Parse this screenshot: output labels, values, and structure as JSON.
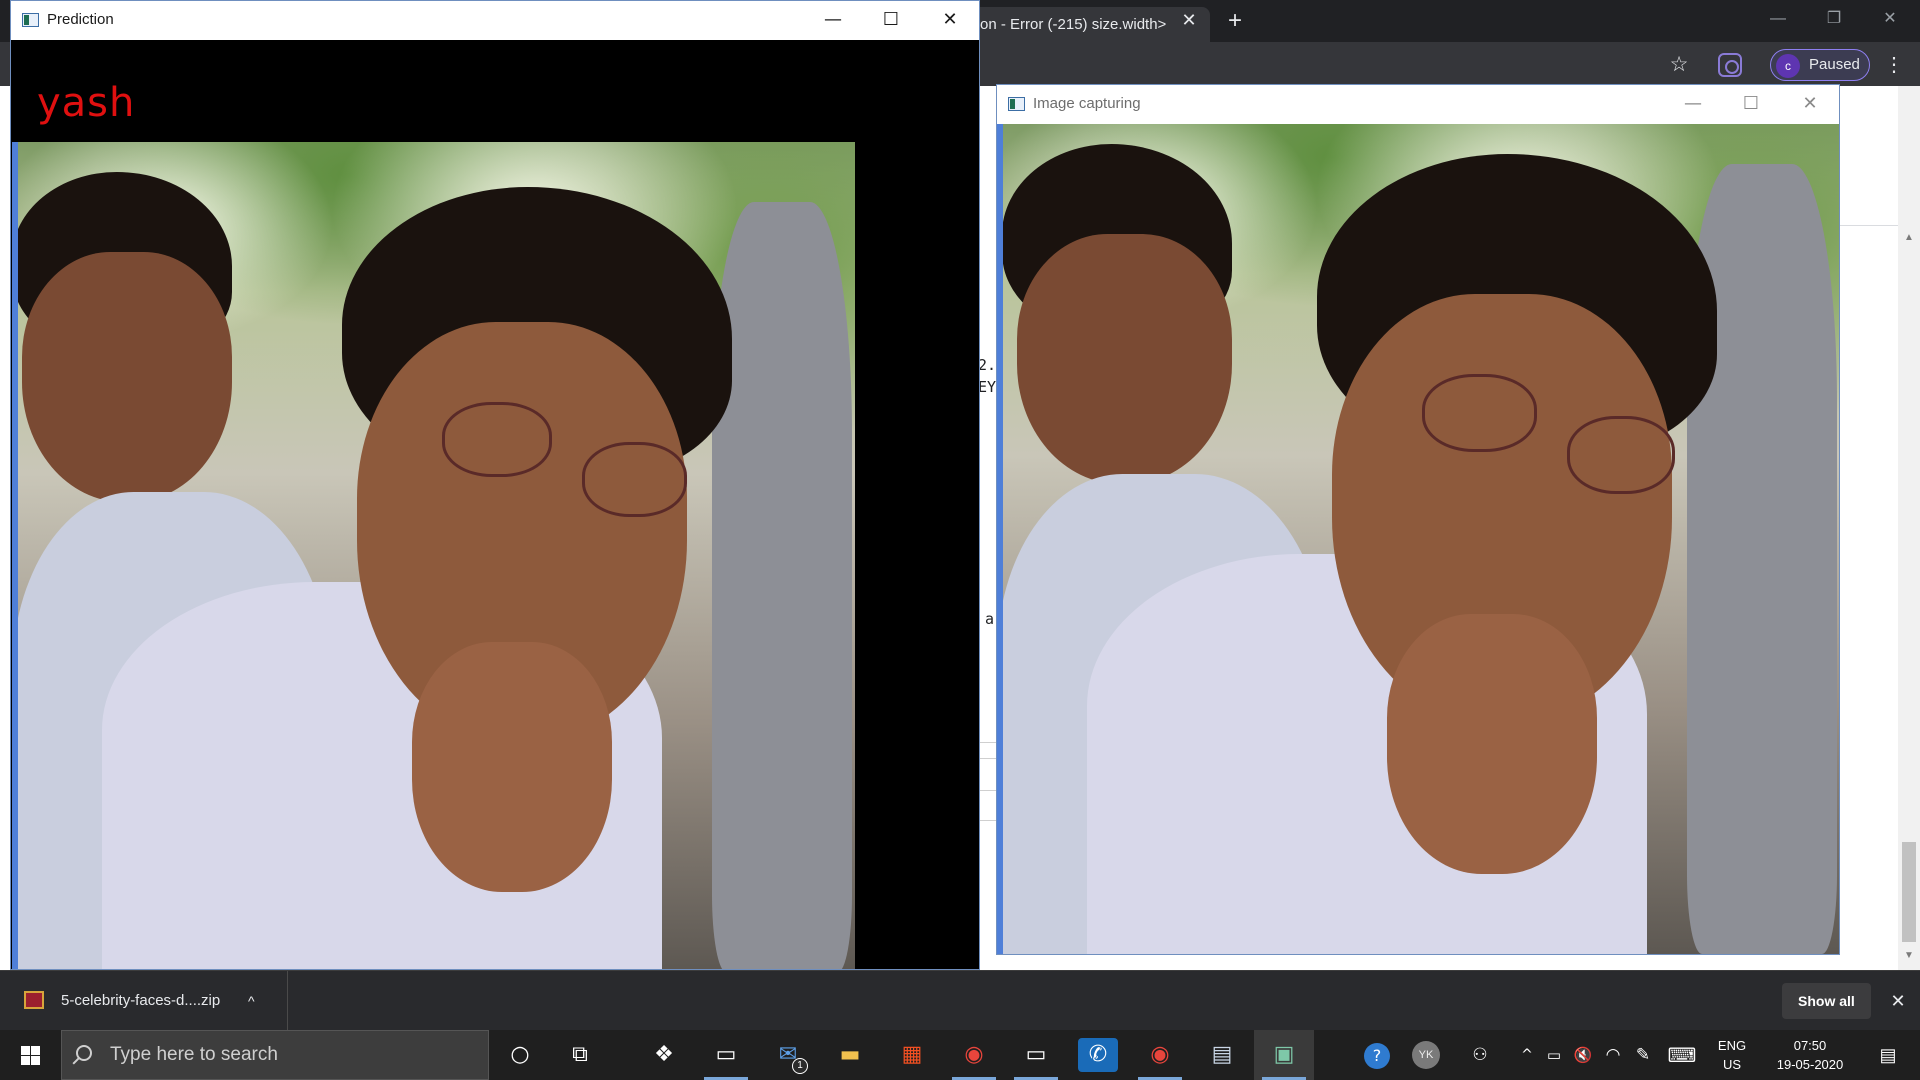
{
  "chrome": {
    "tab_title": "on - Error (-215) size.width>",
    "tab_close": "✕",
    "new_tab": "+",
    "window_controls": [
      "—",
      "❐",
      "✕"
    ],
    "star": "☆",
    "profile_initial": "c",
    "profile_status": "Paused",
    "menu": "⋮",
    "page_fragments": [
      "2.",
      "EY",
      "a"
    ],
    "scroll_up": "▲",
    "scroll_down": "▼"
  },
  "prediction_window": {
    "title": "Prediction",
    "minimize": "—",
    "maximize": "☐",
    "close": "✕",
    "predicted_label": "yash",
    "label_color": "#e01010"
  },
  "capture_window": {
    "title": "Image capturing",
    "minimize": "—",
    "maximize": "☐",
    "close": "✕"
  },
  "download_bar": {
    "file_name": "5-celebrity-faces-d....zip",
    "chevron": "^",
    "show_all": "Show all",
    "close": "✕"
  },
  "taskbar": {
    "search_placeholder": "Type here to search",
    "apps": [
      {
        "name": "cortana",
        "glyph": "○"
      },
      {
        "name": "task-view",
        "glyph": "⧉"
      },
      {
        "name": "dropbox",
        "glyph": "❖"
      },
      {
        "name": "terminal",
        "glyph": "▭"
      },
      {
        "name": "mail",
        "glyph": "✉"
      },
      {
        "name": "file-explorer",
        "glyph": "▬"
      },
      {
        "name": "store",
        "glyph": "▦"
      },
      {
        "name": "chrome",
        "glyph": "◉"
      },
      {
        "name": "terminal-2",
        "glyph": "▭"
      },
      {
        "name": "whatsapp",
        "glyph": "✆"
      },
      {
        "name": "chrome-2",
        "glyph": "◉"
      },
      {
        "name": "app-misc",
        "glyph": "▤"
      },
      {
        "name": "opencv-window",
        "glyph": "▣"
      }
    ],
    "mail_badge": "1",
    "tray": {
      "help": "?",
      "user_initials": "YK",
      "people": "⚇",
      "chevron": "^",
      "battery": "▭",
      "volume": "🔇",
      "wifi": "◠",
      "pen": "✎",
      "keyboard": "⌨",
      "lang_line1": "ENG",
      "lang_line2": "US",
      "time": "07:50",
      "date": "19-05-2020",
      "notifications": "▤"
    }
  }
}
